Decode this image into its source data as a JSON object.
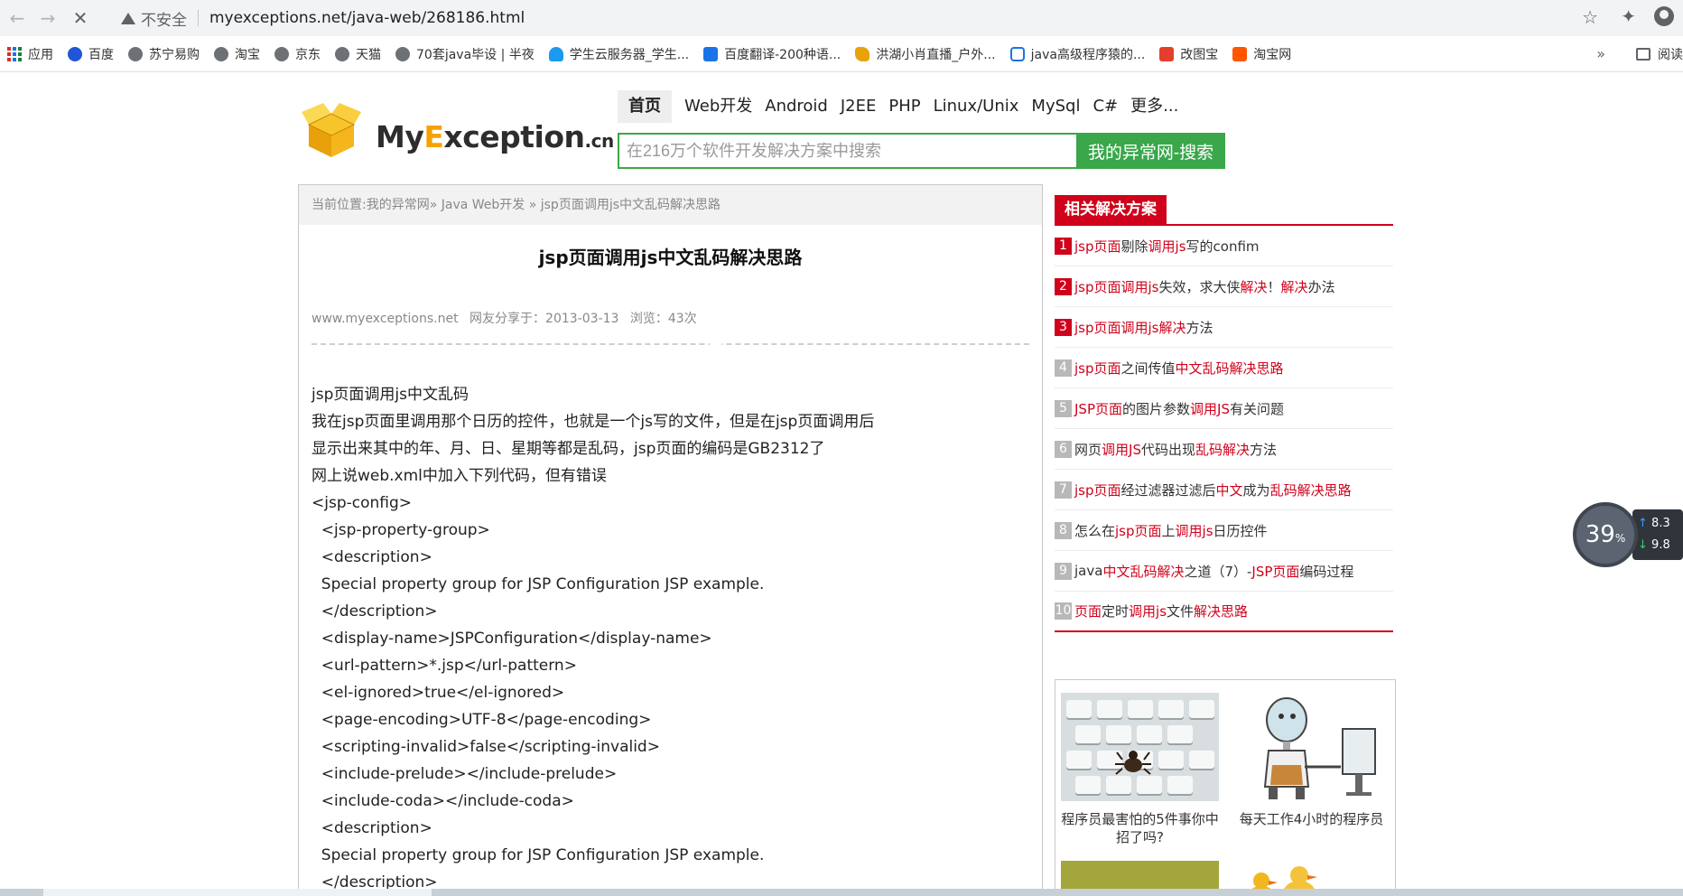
{
  "browser": {
    "security_label": "不安全",
    "url": "myexceptions.net/java-web/268186.html"
  },
  "bookmarks": {
    "items": [
      {
        "label": "应用",
        "icon": "apps-grid-icon"
      },
      {
        "label": "百度",
        "icon": "baidu-paw-icon"
      },
      {
        "label": "苏宁易购",
        "icon": "globe-icon"
      },
      {
        "label": "淘宝",
        "icon": "globe-icon"
      },
      {
        "label": "京东",
        "icon": "globe-icon"
      },
      {
        "label": "天猫",
        "icon": "globe-icon"
      },
      {
        "label": "70套java毕设 | 半夜",
        "icon": "globe-icon"
      },
      {
        "label": "学生云服务器_学生...",
        "icon": "cloud-icon"
      },
      {
        "label": "百度翻译-200种语...",
        "icon": "translate-icon"
      },
      {
        "label": "洪湖小肖直播_户外...",
        "icon": "live-icon"
      },
      {
        "label": "java高级程序猿的...",
        "icon": "tv-icon"
      },
      {
        "label": "改图宝",
        "icon": "image-edit-icon"
      },
      {
        "label": "淘宝网",
        "icon": "taobao-icon"
      }
    ],
    "more_label": "»",
    "reading_label": "阅读"
  },
  "site": {
    "logo_my": "My",
    "logo_e": "E",
    "logo_rest": "xception",
    "logo_cn": ".cn",
    "nav": [
      "首页",
      "Web开发",
      "Android",
      "J2EE",
      "PHP",
      "Linux/Unix",
      "MySql",
      "C#",
      "更多..."
    ],
    "search_placeholder": "在216万个软件开发解决方案中搜索",
    "search_button": "我的异常网-搜索"
  },
  "article": {
    "breadcrumb": "当前位置:我的异常网» Java Web开发 » jsp页面调用js中文乱码解决思路",
    "title": "jsp页面调用js中文乱码解决思路",
    "meta_source": "www.myexceptions.net",
    "meta_shared": "网友分享于：2013-03-13",
    "meta_views": "浏览：43次",
    "lines": [
      "jsp页面调用js中文乱码",
      "我在jsp页面里调用那个日历的控件，也就是一个js写的文件，但是在jsp页面调用后",
      "显示出来其中的年、月、日、星期等都是乱码，jsp页面的编码是GB2312了",
      "网上说web.xml中加入下列代码，但有错误",
      "<jsp-config>",
      "  <jsp-property-group>",
      "  <description>",
      "  Special property group for JSP Configuration JSP example.",
      "  </description>",
      "  <display-name>JSPConfiguration</display-name>",
      "  <url-pattern>*.jsp</url-pattern>",
      "  <el-ignored>true</el-ignored>",
      "  <page-encoding>UTF-8</page-encoding>",
      "  <scripting-invalid>false</scripting-invalid>",
      "  <include-prelude></include-prelude>",
      "  <include-coda></include-coda>",
      "  <description>",
      "  Special property group for JSP Configuration JSP example.",
      "  </description>"
    ]
  },
  "sidebar": {
    "heading": "相关解决方案",
    "items": [
      {
        "num": "1",
        "parts": [
          [
            "jsp页面",
            1
          ],
          [
            "剔除",
            0
          ],
          [
            "调用js",
            1
          ],
          [
            "写的confim",
            0
          ]
        ]
      },
      {
        "num": "2",
        "parts": [
          [
            "jsp页面调用js",
            1
          ],
          [
            "失效，求大侠",
            0
          ],
          [
            "解决",
            1
          ],
          [
            "！",
            0
          ],
          [
            "解决",
            1
          ],
          [
            "办法",
            0
          ]
        ]
      },
      {
        "num": "3",
        "parts": [
          [
            "jsp页面调用js解决",
            1
          ],
          [
            "方法",
            0
          ]
        ]
      },
      {
        "num": "4",
        "parts": [
          [
            "jsp页面",
            1
          ],
          [
            "之间传值",
            0
          ],
          [
            "中文乱码解决思路",
            1
          ]
        ]
      },
      {
        "num": "5",
        "parts": [
          [
            "JSP页面",
            1
          ],
          [
            "的图片参数",
            0
          ],
          [
            "调用JS",
            1
          ],
          [
            "有关问题",
            0
          ]
        ]
      },
      {
        "num": "6",
        "parts": [
          [
            "网页",
            0
          ],
          [
            "调用JS",
            1
          ],
          [
            "代码出现",
            0
          ],
          [
            "乱码解决",
            1
          ],
          [
            "方法",
            0
          ]
        ]
      },
      {
        "num": "7",
        "parts": [
          [
            "jsp页面",
            1
          ],
          [
            "经过滤器过滤后",
            0
          ],
          [
            "中文",
            1
          ],
          [
            "成为",
            0
          ],
          [
            "乱码解决思路",
            1
          ]
        ]
      },
      {
        "num": "8",
        "parts": [
          [
            "怎么在",
            0
          ],
          [
            "jsp页面",
            1
          ],
          [
            "上",
            0
          ],
          [
            "调用js",
            1
          ],
          [
            "日历控件",
            0
          ]
        ]
      },
      {
        "num": "9",
        "parts": [
          [
            "java",
            0
          ],
          [
            "中文乱码解决",
            1
          ],
          [
            "之道（7）-",
            0
          ],
          [
            "JSP页面",
            1
          ],
          [
            "编码过程",
            0
          ]
        ]
      },
      {
        "num": "10",
        "parts": [
          [
            "页面",
            1
          ],
          [
            "定时",
            0
          ],
          [
            "调用js",
            1
          ],
          [
            "文件",
            0
          ],
          [
            "解决思路",
            1
          ]
        ]
      }
    ],
    "promos": [
      {
        "caption": "程序员最害怕的5件事你中招了吗?"
      },
      {
        "caption": "每天工作4小时的程序员"
      }
    ]
  },
  "widget": {
    "percent": "39",
    "percent_unit": "%",
    "up": "8.3",
    "down": "9.8"
  },
  "colors": {
    "accent_green": "#39a74a",
    "accent_red": "#d0021b"
  }
}
